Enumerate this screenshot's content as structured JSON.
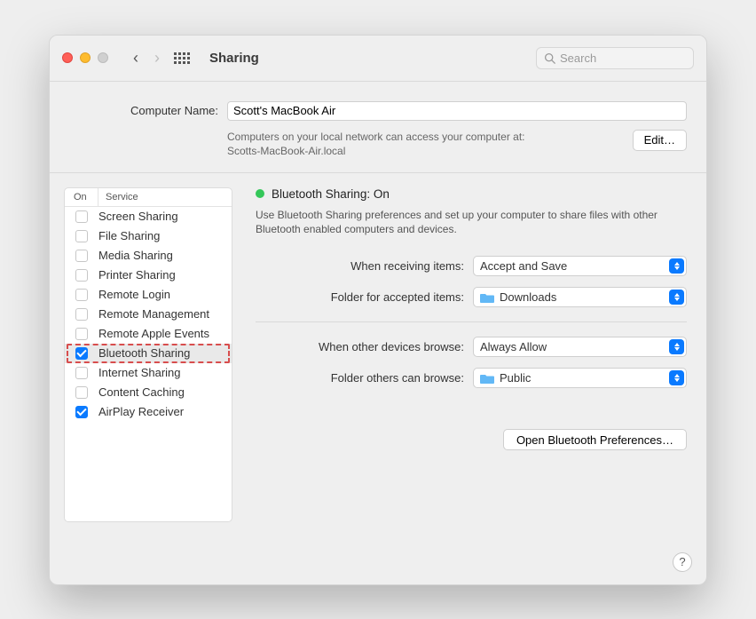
{
  "window": {
    "title": "Sharing"
  },
  "search": {
    "placeholder": "Search"
  },
  "header": {
    "name_label": "Computer Name:",
    "name_value": "Scott's MacBook Air",
    "desc_line1": "Computers on your local network can access your computer at:",
    "desc_line2": "Scotts-MacBook-Air.local",
    "edit_label": "Edit…"
  },
  "services": {
    "col_on": "On",
    "col_service": "Service",
    "items": [
      {
        "label": "Screen Sharing",
        "checked": false
      },
      {
        "label": "File Sharing",
        "checked": false
      },
      {
        "label": "Media Sharing",
        "checked": false
      },
      {
        "label": "Printer Sharing",
        "checked": false
      },
      {
        "label": "Remote Login",
        "checked": false
      },
      {
        "label": "Remote Management",
        "checked": false
      },
      {
        "label": "Remote Apple Events",
        "checked": false
      },
      {
        "label": "Bluetooth Sharing",
        "checked": true,
        "selected": true,
        "highlighted": true
      },
      {
        "label": "Internet Sharing",
        "checked": false
      },
      {
        "label": "Content Caching",
        "checked": false
      },
      {
        "label": "AirPlay Receiver",
        "checked": true
      }
    ]
  },
  "detail": {
    "status_title": "Bluetooth Sharing: On",
    "status_desc": "Use Bluetooth Sharing preferences and set up your computer to share files with other Bluetooth enabled computers and devices.",
    "receive_label": "When receiving items:",
    "receive_value": "Accept and Save",
    "accept_folder_label": "Folder for accepted items:",
    "accept_folder_value": "Downloads",
    "browse_label": "When other devices browse:",
    "browse_value": "Always Allow",
    "browse_folder_label": "Folder others can browse:",
    "browse_folder_value": "Public",
    "open_prefs_label": "Open Bluetooth Preferences…"
  },
  "help_label": "?"
}
